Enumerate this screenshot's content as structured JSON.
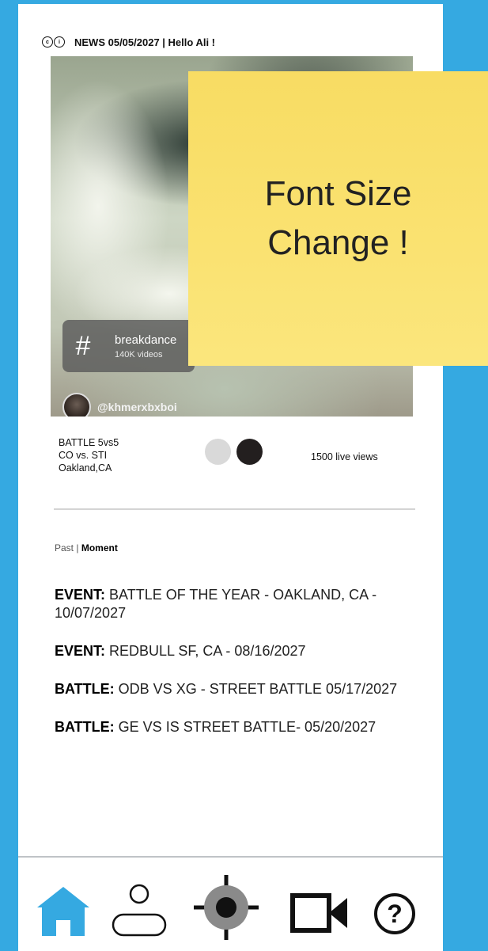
{
  "header": {
    "logo_text": "cc",
    "title": "NEWS 05/05/2027 | Hello Ali !"
  },
  "video": {
    "hashtag_symbol": "#",
    "hashtag_name": "breakdance",
    "hashtag_count": "140K videos",
    "handle": "@khmerxbxboi"
  },
  "sticky_note": {
    "line1": "Font Size",
    "line2": "Change !"
  },
  "event_info": {
    "line1": "BATTLE 5vs5",
    "line2": "CO vs. STI",
    "line3": "Oakland,CA",
    "views": "1500 live views"
  },
  "tabs": {
    "past": "Past",
    "separator": "|",
    "moment": "Moment"
  },
  "events": [
    {
      "keyword": "EVENT:",
      "text": "BATTLE OF THE YEAR - OAKLAND, CA - 10/07/2027"
    },
    {
      "keyword": "EVENT:",
      "text": "REDBULL SF, CA - 08/16/2027"
    },
    {
      "keyword": "BATTLE:",
      "text": "ODB VS XG - STREET BATTLE 05/17/2027"
    },
    {
      "keyword": "BATTLE:",
      "text": "GE VS IS STREET BATTLE- 05/20/2027"
    }
  ],
  "nav": {
    "items": [
      "home-icon",
      "profile-icon",
      "location-icon",
      "video-camera-icon",
      "help-icon"
    ],
    "accent_color": "#35a9e1"
  },
  "colors": {
    "background": "#35a9e1",
    "sticky": "#f8dc63"
  }
}
